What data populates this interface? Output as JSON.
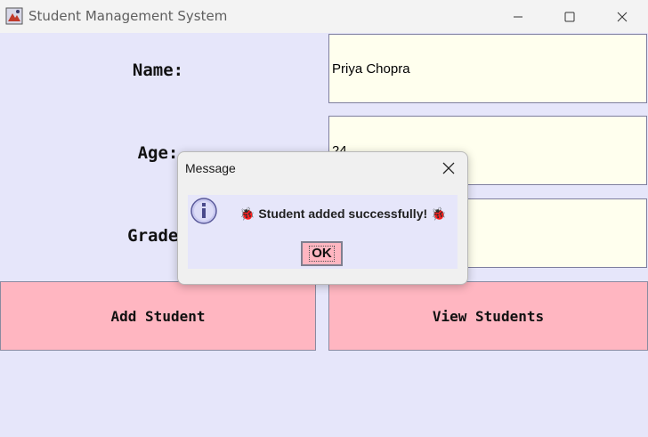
{
  "window": {
    "title": "Student Management System"
  },
  "form": {
    "name_label": "Name:",
    "name_value": "Priya Chopra",
    "age_label": "Age:",
    "age_value": "24",
    "grade_label": "Grade:",
    "grade_value": ""
  },
  "buttons": {
    "add_student": "Add Student",
    "view_students": "View Students"
  },
  "dialog": {
    "title": "Message",
    "message": "🐞 Student added successfully! 🐞",
    "ok_label": "OK",
    "icon": "info-icon"
  },
  "colors": {
    "background": "#e6e6fa",
    "field_bg": "#ffffee",
    "button_bg": "#ffb6c1"
  }
}
